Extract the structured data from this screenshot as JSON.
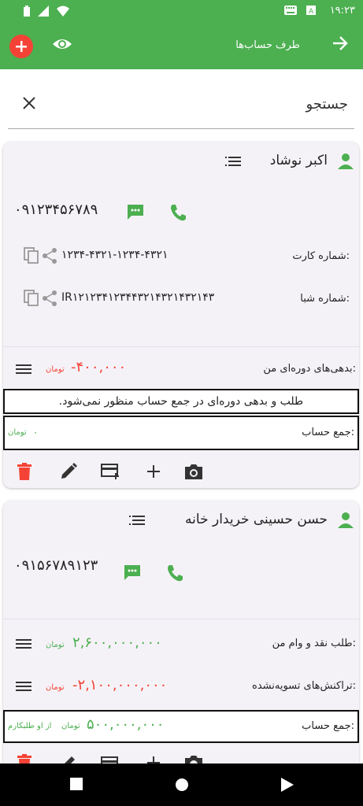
{
  "status_bar": {
    "time": "۱۹:۲۳"
  },
  "app_bar": {
    "title": "طرف حساب‌ها"
  },
  "search": {
    "placeholder": "جستجو"
  },
  "colors": {
    "accent": "#4caf50",
    "danger": "#f44336"
  },
  "contacts": [
    {
      "name": "اکبر نوشاد",
      "phone": "۰۹۱۲۳۴۵۶۷۸۹",
      "card_label": "شماره کارت:",
      "card_number": "۱۲۳۴-۴۳۲۱-۱۲۳۴-۴۳۲۱",
      "sheba_label": "شماره شبا:",
      "sheba_number": "IR۱۲۱۲۳۴۱۲۳۴۴۳۲۱۴۳۲۱۴۳۲۱۴۳",
      "periodic_label": "بدهی‌های دوره‌ای من:",
      "periodic_amount": "-۴۰۰,۰۰۰",
      "periodic_unit": "تومان",
      "note": "طلب و بدهی دوره‌ای در جمع حساب منظور نمی‌شود.",
      "total_label": "جمع حساب:",
      "total_amount": "۰",
      "total_unit": "تومان"
    },
    {
      "name": "حسن حسینی خریدار خانه",
      "phone": "۰۹۱۵۶۷۸۹۱۲۳",
      "loan_label": "طلب نقد و وام من:",
      "loan_amount": "۲,۶۰۰,۰۰۰,۰۰۰",
      "loan_unit": "تومان",
      "unsettled_label": "تراکنش‌های تسویه‌نشده:",
      "unsettled_amount": "-۲,۱۰۰,۰۰۰,۰۰۰",
      "unsettled_unit": "تومان",
      "total_label": "جمع حساب:",
      "total_amount": "۵۰۰,۰۰۰,۰۰۰",
      "total_unit": "تومان",
      "total_note": "از او طلبکارم"
    }
  ]
}
